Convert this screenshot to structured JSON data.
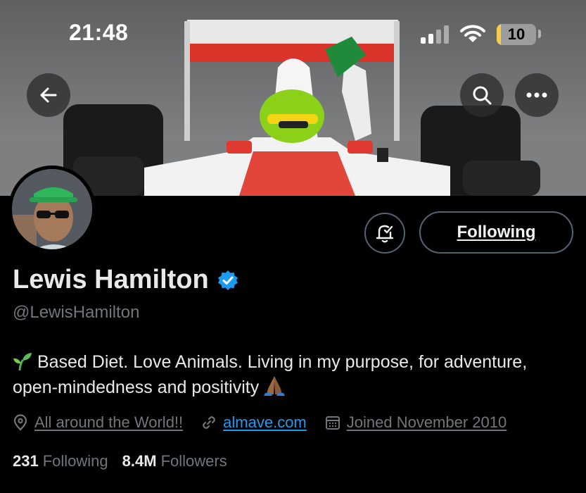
{
  "status_bar": {
    "time": "21:48",
    "battery_level": "10",
    "battery_fraction": 0.1,
    "icons": [
      "cellular-signal-icon",
      "wifi-icon",
      "battery-icon"
    ]
  },
  "header": {
    "icons": [
      "back-arrow-icon",
      "search-icon",
      "more-horizontal-icon"
    ]
  },
  "profile": {
    "display_name": "Lewis Hamilton",
    "handle": "@LewisHamilton",
    "verified": true,
    "bio_text": "Based Diet. Love Animals. Living in my purpose, for adventure, open-mindedness and positivity",
    "bio_emojis": [
      "seedling-icon",
      "folded-hands-icon"
    ],
    "location": "All around the World!!",
    "website": "almave.com",
    "joined": "Joined November 2010",
    "following_count": "231",
    "following_label": "Following",
    "followers_count": "8.4M",
    "followers_label": "Followers"
  },
  "actions": {
    "following_button": "Following",
    "notify_icon": "bell-check-icon"
  },
  "colors": {
    "background": "#000000",
    "text_primary": "#e7e9ea",
    "text_secondary": "#71767b",
    "link": "#1d9bf0",
    "verified": "#1d9bf0",
    "button_border": "#536471",
    "battery_fill": "#f7ce46"
  }
}
